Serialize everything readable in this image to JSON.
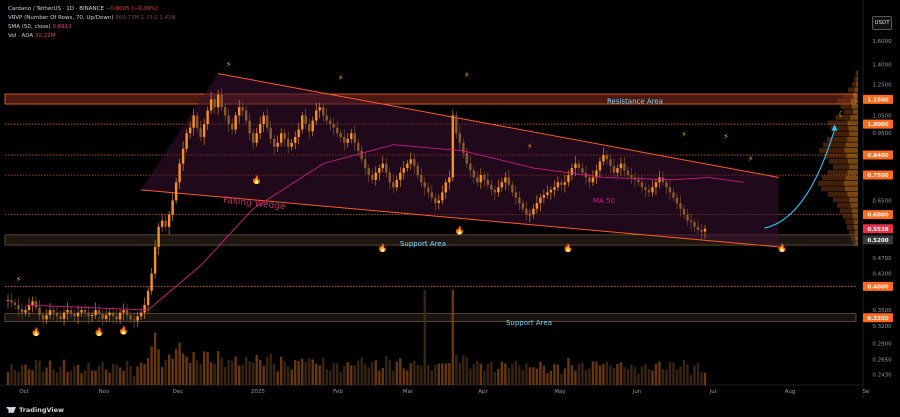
{
  "legend": {
    "title": "Cardano / TetherUS · 1D · BINANCE",
    "change": "−0.0005 (−0.09%)",
    "vrvp": "VRVP (Number Of Rows, 70, Up/Down)",
    "vrvp_vals": "869.73M  1.31G  1.41B",
    "sma": "SMA (50, close)",
    "sma_val": "0.6913",
    "vol": "Vol · ADA",
    "vol_val": "30.22M"
  },
  "currency": "USDT",
  "brand": "TradingView",
  "colors": {
    "background": "#000000",
    "up": "#f7931a",
    "down": "#8a5a2b",
    "wedge_line": "#ff5a2a",
    "wedge_fill": "#3a1030",
    "ma": "#d01a8a",
    "resistance": "#ff6a30",
    "support_zone": "#553a20",
    "projection": "#2ec4ff",
    "text_label": "#7fd8ff"
  },
  "chart_data": {
    "type": "candlestick",
    "scale": "log",
    "ylim": [
      0.2292,
      1.8
    ],
    "y_ticks": [
      "1.6000",
      "1.4000",
      "1.2500",
      "1.0500",
      "0.9500",
      "0.8500",
      "0.6500",
      "0.4700",
      "0.4300",
      "0.3500",
      "0.3200",
      "0.2900",
      "0.2650",
      "0.2430"
    ],
    "x_ticks": [
      "Oct",
      "Nov",
      "Dec",
      "2025",
      "Feb",
      "Mar",
      "Apr",
      "May",
      "Jun",
      "Jul",
      "Aug",
      "Se"
    ],
    "price_badges": [
      {
        "label": "1.1500",
        "value": 1.15
      },
      {
        "label": "1.0000",
        "value": 1.0
      },
      {
        "label": "0.8400",
        "value": 0.84
      },
      {
        "label": "0.7500",
        "value": 0.75
      },
      {
        "label": "0.6000",
        "value": 0.6
      },
      {
        "label": "0.5538",
        "value": 0.5538
      },
      {
        "label": "0.5200",
        "value": 0.52
      },
      {
        "label": "0.4000",
        "value": 0.4
      },
      {
        "label": "0.3350",
        "value": 0.335
      }
    ],
    "annotations": {
      "resistance": "Resistance Area",
      "support_upper": "Support Area",
      "support_lower": "Support Area",
      "wedge": "Falling Wedge",
      "ma": "MA 50"
    },
    "closes": [
      0.37,
      0.365,
      0.36,
      0.352,
      0.345,
      0.35,
      0.36,
      0.368,
      0.355,
      0.34,
      0.332,
      0.34,
      0.35,
      0.345,
      0.338,
      0.333,
      0.345,
      0.35,
      0.342,
      0.338,
      0.345,
      0.35,
      0.345,
      0.338,
      0.34,
      0.35,
      0.342,
      0.333,
      0.34,
      0.345,
      0.338,
      0.332,
      0.345,
      0.35,
      0.34,
      0.332,
      0.33,
      0.338,
      0.345,
      0.36,
      0.39,
      0.43,
      0.5,
      0.56,
      0.58,
      0.56,
      0.6,
      0.65,
      0.72,
      0.8,
      0.87,
      0.95,
      0.98,
      1.05,
      0.98,
      0.93,
      1.0,
      1.08,
      1.15,
      1.1,
      1.18,
      1.1,
      1.05,
      1.0,
      0.97,
      1.05,
      1.1,
      1.08,
      1.02,
      0.95,
      0.9,
      0.95,
      1.0,
      1.05,
      0.98,
      0.92,
      0.88,
      0.9,
      0.95,
      0.92,
      0.88,
      0.9,
      0.93,
      0.97,
      1.05,
      1.0,
      0.96,
      1.02,
      1.08,
      1.1,
      1.05,
      1.02,
      1.0,
      0.98,
      0.95,
      0.93,
      0.9,
      0.92,
      0.95,
      0.9,
      0.86,
      0.82,
      0.78,
      0.75,
      0.73,
      0.76,
      0.78,
      0.8,
      0.76,
      0.72,
      0.7,
      0.73,
      0.76,
      0.78,
      0.8,
      0.82,
      0.79,
      0.75,
      0.72,
      0.7,
      0.68,
      0.66,
      0.64,
      0.65,
      0.68,
      0.72,
      0.74,
      1.05,
      0.95,
      0.9,
      0.85,
      0.8,
      0.77,
      0.74,
      0.72,
      0.75,
      0.73,
      0.71,
      0.69,
      0.68,
      0.7,
      0.72,
      0.74,
      0.71,
      0.68,
      0.66,
      0.64,
      0.62,
      0.6,
      0.6,
      0.62,
      0.64,
      0.66,
      0.67,
      0.68,
      0.69,
      0.7,
      0.72,
      0.71,
      0.72,
      0.75,
      0.78,
      0.8,
      0.78,
      0.76,
      0.74,
      0.72,
      0.74,
      0.77,
      0.81,
      0.84,
      0.82,
      0.79,
      0.76,
      0.78,
      0.8,
      0.77,
      0.75,
      0.74,
      0.73,
      0.72,
      0.7,
      0.69,
      0.68,
      0.7,
      0.72,
      0.74,
      0.72,
      0.7,
      0.68,
      0.66,
      0.64,
      0.62,
      0.6,
      0.58,
      0.575,
      0.56,
      0.55,
      0.545,
      0.5538
    ],
    "ma50": [
      [
        5,
        0.36
      ],
      [
        40,
        0.35
      ],
      [
        55,
        0.45
      ],
      [
        70,
        0.62
      ],
      [
        90,
        0.8
      ],
      [
        110,
        0.89
      ],
      [
        130,
        0.86
      ],
      [
        150,
        0.78
      ],
      [
        170,
        0.74
      ],
      [
        190,
        0.73
      ],
      [
        200,
        0.74
      ],
      [
        210,
        0.72
      ]
    ],
    "wedge_upper": [
      [
        60,
        1.33
      ],
      [
        220,
        0.74
      ]
    ],
    "wedge_lower": [
      [
        38,
        0.69
      ],
      [
        220,
        0.5
      ]
    ],
    "projection": [
      [
        216,
        0.556
      ],
      [
        226,
        0.6
      ],
      [
        232,
        0.75
      ],
      [
        236,
        0.97
      ]
    ]
  }
}
